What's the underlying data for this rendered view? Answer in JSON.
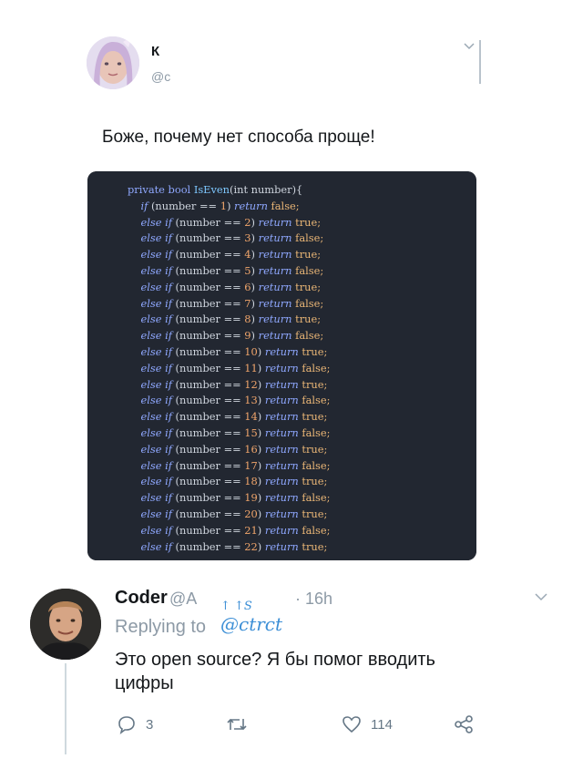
{
  "tweet": {
    "author_name": "К",
    "author_handle": "@c",
    "text": "Боже, почему нет способа проще!",
    "code_lines": [
      {
        "pre": "private bool ",
        "fn": "IsEven",
        "mid": "(int number){",
        "num": "",
        "tail": "",
        "ret": "",
        "val": "",
        "kind": "header"
      },
      {
        "pre": "if",
        "fn": "",
        "mid": " (number == ",
        "num": "1",
        "tail": ") ",
        "ret": "return",
        "val": " false;",
        "kind": "first"
      },
      {
        "pre": "else if",
        "mid": " (number == ",
        "num": "2",
        "tail": ") ",
        "ret": "return",
        "val": " true;",
        "kind": "elif"
      },
      {
        "pre": "else if",
        "mid": " (number == ",
        "num": "3",
        "tail": ") ",
        "ret": "return",
        "val": " false;",
        "kind": "elif"
      },
      {
        "pre": "else if",
        "mid": " (number == ",
        "num": "4",
        "tail": ") ",
        "ret": "return",
        "val": " true;",
        "kind": "elif"
      },
      {
        "pre": "else if",
        "mid": " (number == ",
        "num": "5",
        "tail": ") ",
        "ret": "return",
        "val": " false;",
        "kind": "elif"
      },
      {
        "pre": "else if",
        "mid": " (number == ",
        "num": "6",
        "tail": ") ",
        "ret": "return",
        "val": " true;",
        "kind": "elif"
      },
      {
        "pre": "else if",
        "mid": " (number == ",
        "num": "7",
        "tail": ") ",
        "ret": "return",
        "val": " false;",
        "kind": "elif"
      },
      {
        "pre": "else if",
        "mid": " (number == ",
        "num": "8",
        "tail": ") ",
        "ret": "return",
        "val": " true;",
        "kind": "elif"
      },
      {
        "pre": "else if",
        "mid": " (number == ",
        "num": "9",
        "tail": ") ",
        "ret": "return",
        "val": " false;",
        "kind": "elif"
      },
      {
        "pre": "else if",
        "mid": " (number == ",
        "num": "10",
        "tail": ") ",
        "ret": "return",
        "val": " true;",
        "kind": "elif"
      },
      {
        "pre": "else if",
        "mid": " (number == ",
        "num": "11",
        "tail": ") ",
        "ret": "return",
        "val": " false;",
        "kind": "elif"
      },
      {
        "pre": "else if",
        "mid": " (number == ",
        "num": "12",
        "tail": ") ",
        "ret": "return",
        "val": " true;",
        "kind": "elif"
      },
      {
        "pre": "else if",
        "mid": " (number == ",
        "num": "13",
        "tail": ") ",
        "ret": "return",
        "val": " false;",
        "kind": "elif"
      },
      {
        "pre": "else if",
        "mid": " (number == ",
        "num": "14",
        "tail": ") ",
        "ret": "return",
        "val": " true;",
        "kind": "elif"
      },
      {
        "pre": "else if",
        "mid": " (number == ",
        "num": "15",
        "tail": ") ",
        "ret": "return",
        "val": " false;",
        "kind": "elif"
      },
      {
        "pre": "else if",
        "mid": " (number == ",
        "num": "16",
        "tail": ") ",
        "ret": "return",
        "val": " true;",
        "kind": "elif"
      },
      {
        "pre": "else if",
        "mid": " (number == ",
        "num": "17",
        "tail": ") ",
        "ret": "return",
        "val": " false;",
        "kind": "elif"
      },
      {
        "pre": "else if",
        "mid": " (number == ",
        "num": "18",
        "tail": ") ",
        "ret": "return",
        "val": " true;",
        "kind": "elif"
      },
      {
        "pre": "else if",
        "mid": " (number == ",
        "num": "19",
        "tail": ") ",
        "ret": "return",
        "val": " false;",
        "kind": "elif"
      },
      {
        "pre": "else if",
        "mid": " (number == ",
        "num": "20",
        "tail": ") ",
        "ret": "return",
        "val": " true;",
        "kind": "elif"
      },
      {
        "pre": "else if",
        "mid": " (number == ",
        "num": "21",
        "tail": ") ",
        "ret": "return",
        "val": " false;",
        "kind": "elif"
      },
      {
        "pre": "else if",
        "mid": " (number == ",
        "num": "22",
        "tail": ") ",
        "ret": "return",
        "val": " true;",
        "kind": "elif"
      }
    ]
  },
  "reply": {
    "author_name": "Coder",
    "author_handle": "@A",
    "time": "· 16h",
    "replying_label": "Replying to",
    "replying_handle": "@ctrct",
    "scribble": "↑ ↑S",
    "text": "Это open source? Я бы помог вводить цифры",
    "actions": {
      "reply_count": "3",
      "like_count": "114"
    }
  },
  "colors": {
    "code_background": "#222731",
    "accent": "#3d8fd6",
    "muted": "#8d9aa6"
  },
  "icons": [
    "chevron-down-icon",
    "reply-icon",
    "retweet-icon",
    "like-icon",
    "share-icon"
  ]
}
